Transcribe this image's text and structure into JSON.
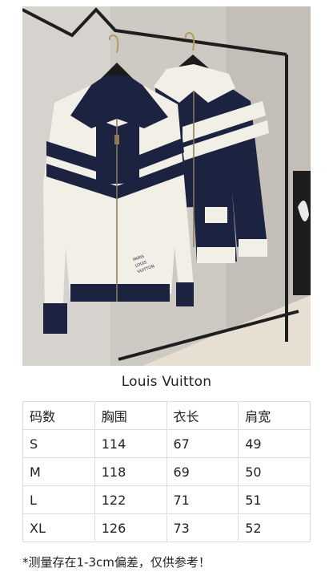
{
  "brand": "Louis Vuitton",
  "photo": {
    "jacket_tag_text": "PARIS LOUIS VUITTON"
  },
  "size_table": {
    "headers": [
      "码数",
      "胸围",
      "衣长",
      "肩宽"
    ],
    "rows": [
      [
        "S",
        "114",
        "67",
        "49"
      ],
      [
        "M",
        "118",
        "69",
        "50"
      ],
      [
        "L",
        "122",
        "71",
        "51"
      ],
      [
        "XL",
        "126",
        "73",
        "52"
      ]
    ]
  },
  "note": "*测量存在1-3cm偏差，仅供参考！",
  "colors": {
    "navy": "#1c2340",
    "cream": "#f2efe7",
    "wall": "#cfcbc6",
    "rack": "#222222"
  }
}
